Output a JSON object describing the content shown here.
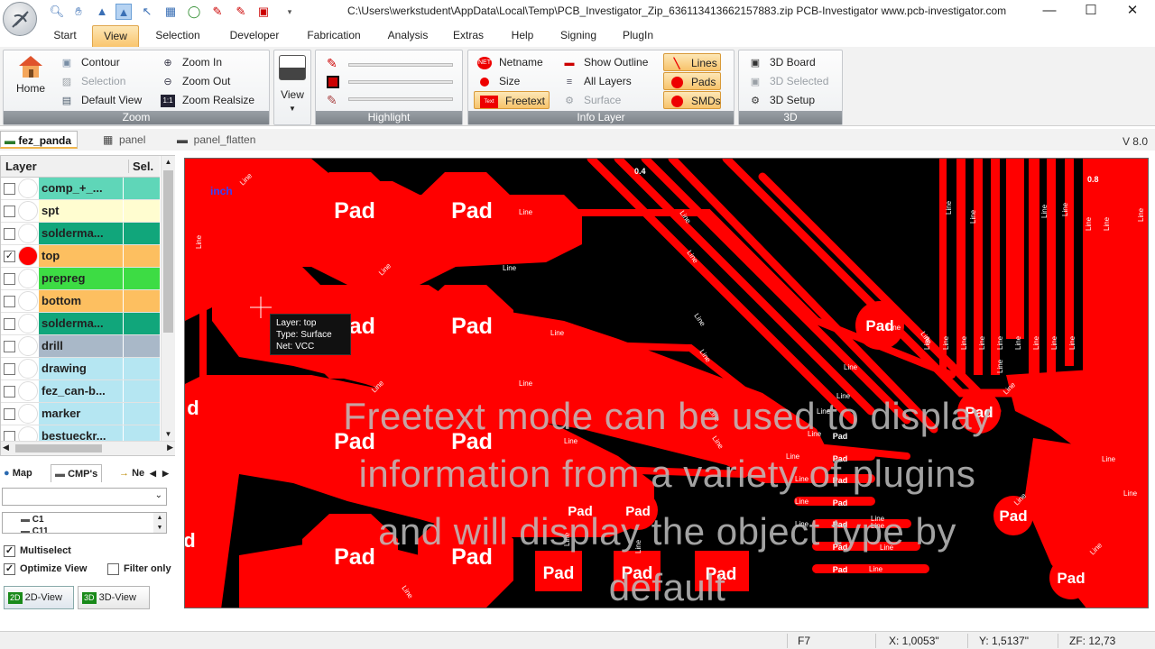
{
  "window": {
    "title": "C:\\Users\\werkstudent\\AppData\\Local\\Temp\\PCB_Investigator_Zip_636113413662157883.zip  PCB-Investigator  www.pcb-investigator.com",
    "minimize_glyph": "—",
    "maximize_glyph": "☐",
    "close_glyph": "✕"
  },
  "quick_access": [
    "search-icon",
    "hand-icon",
    "arrow-up-icon",
    "select-arrow-icon",
    "cursor-icon",
    "grid-icon",
    "circle-icon",
    "pen-icon",
    "pen2-icon",
    "pad-icon",
    "dropdown-icon"
  ],
  "menu": {
    "tabs": [
      "Start",
      "View",
      "Selection",
      "Developer",
      "Fabrication",
      "Analysis",
      "Extras",
      "Help",
      "Signing",
      "PlugIn"
    ],
    "active": "View"
  },
  "ribbon": {
    "home_label": "Home",
    "zoom": {
      "label": "Zoom",
      "contour": "Contour",
      "selection": "Selection",
      "default_view": "Default View",
      "zoom_in": "Zoom In",
      "zoom_out": "Zoom Out",
      "zoom_realsize": "Zoom Realsize"
    },
    "view_label": "View",
    "highlight_label": "Highlight",
    "info_layer": {
      "label": "Info Layer",
      "netname": "Netname",
      "size": "Size",
      "freetext": "Freetext",
      "show_outline": "Show Outline",
      "all_layers": "All Layers",
      "surface": "Surface",
      "lines": "Lines",
      "pads": "Pads",
      "smds": "SMDs"
    },
    "three_d": {
      "label": "3D",
      "board": "3D Board",
      "selected": "3D Selected",
      "setup": "3D Setup"
    }
  },
  "doc_tabs": [
    "fez_panda",
    "panel",
    "panel_flatten"
  ],
  "version": "V 8.0",
  "layers": {
    "header_layer": "Layer",
    "header_sel": "Sel.",
    "items": [
      {
        "name": "comp_+_...",
        "checked": false,
        "color": "#5fd6b8",
        "selcolor": "#5fd6b8",
        "dot": "#ffffff"
      },
      {
        "name": "spt",
        "checked": false,
        "color": "#fffdd0",
        "selcolor": "#fffdd0",
        "dot": "#ffffff"
      },
      {
        "name": "solderma...",
        "checked": false,
        "color": "#11a67b",
        "selcolor": "#11a67b",
        "dot": "#ffffff"
      },
      {
        "name": "top",
        "checked": true,
        "color": "#fdbf60",
        "selcolor": "#fdbf60",
        "dot": "#ff0000"
      },
      {
        "name": "prepreg",
        "checked": false,
        "color": "#3ddc44",
        "selcolor": "#3ddc44",
        "dot": "#ffffff"
      },
      {
        "name": "bottom",
        "checked": false,
        "color": "#fdbf60",
        "selcolor": "#fdbf60",
        "dot": "#ffffff"
      },
      {
        "name": "solderma...",
        "checked": false,
        "color": "#11a67b",
        "selcolor": "#11a67b",
        "dot": "#ffffff"
      },
      {
        "name": "drill",
        "checked": false,
        "color": "#a9b8c8",
        "selcolor": "#a9b8c8",
        "dot": "#ffffff"
      },
      {
        "name": "drawing",
        "checked": false,
        "color": "#b5e6f2",
        "selcolor": "#b5e6f2",
        "dot": "#ffffff"
      },
      {
        "name": "fez_can-b...",
        "checked": false,
        "color": "#b5e6f2",
        "selcolor": "#b5e6f2",
        "dot": "#ffffff"
      },
      {
        "name": "marker",
        "checked": false,
        "color": "#b5e6f2",
        "selcolor": "#b5e6f2",
        "dot": "#ffffff"
      },
      {
        "name": "bestueckr...",
        "checked": false,
        "color": "#b5e6f2",
        "selcolor": "#b5e6f2",
        "dot": "#ffffff"
      }
    ]
  },
  "left_tabs": {
    "map": "Map",
    "cmps": "CMP's",
    "net": "Ne"
  },
  "cmp_tree": {
    "item1": "C1",
    "item2": "C11"
  },
  "options": {
    "multiselect": "Multiselect",
    "optimize_view": "Optimize View",
    "filter_only": "Filter only"
  },
  "view_buttons": {
    "two_d": "2D-View",
    "three_d": "3D-View"
  },
  "canvas": {
    "inch_label": "inch",
    "pad_label": "Pad",
    "line_label": "Line",
    "pad_fragment": "d",
    "marker_04": "0.4",
    "marker_08": "0.8",
    "freetext": [
      "Freetext mode can be used to display",
      "information from a variety of plugins",
      "and will display the object type by",
      "default"
    ],
    "tooltip": {
      "layer": "Layer:  top",
      "type": "Type:   Surface",
      "net": "Net:    VCC"
    }
  },
  "status": {
    "key": "F7",
    "x": "X: 1,0053\"",
    "y": "Y: 1,5137\"",
    "zoom": "ZF: 12,73"
  },
  "colors": {
    "copper": "#ff0000",
    "board": "#000000",
    "accent": "#f7c36b"
  }
}
